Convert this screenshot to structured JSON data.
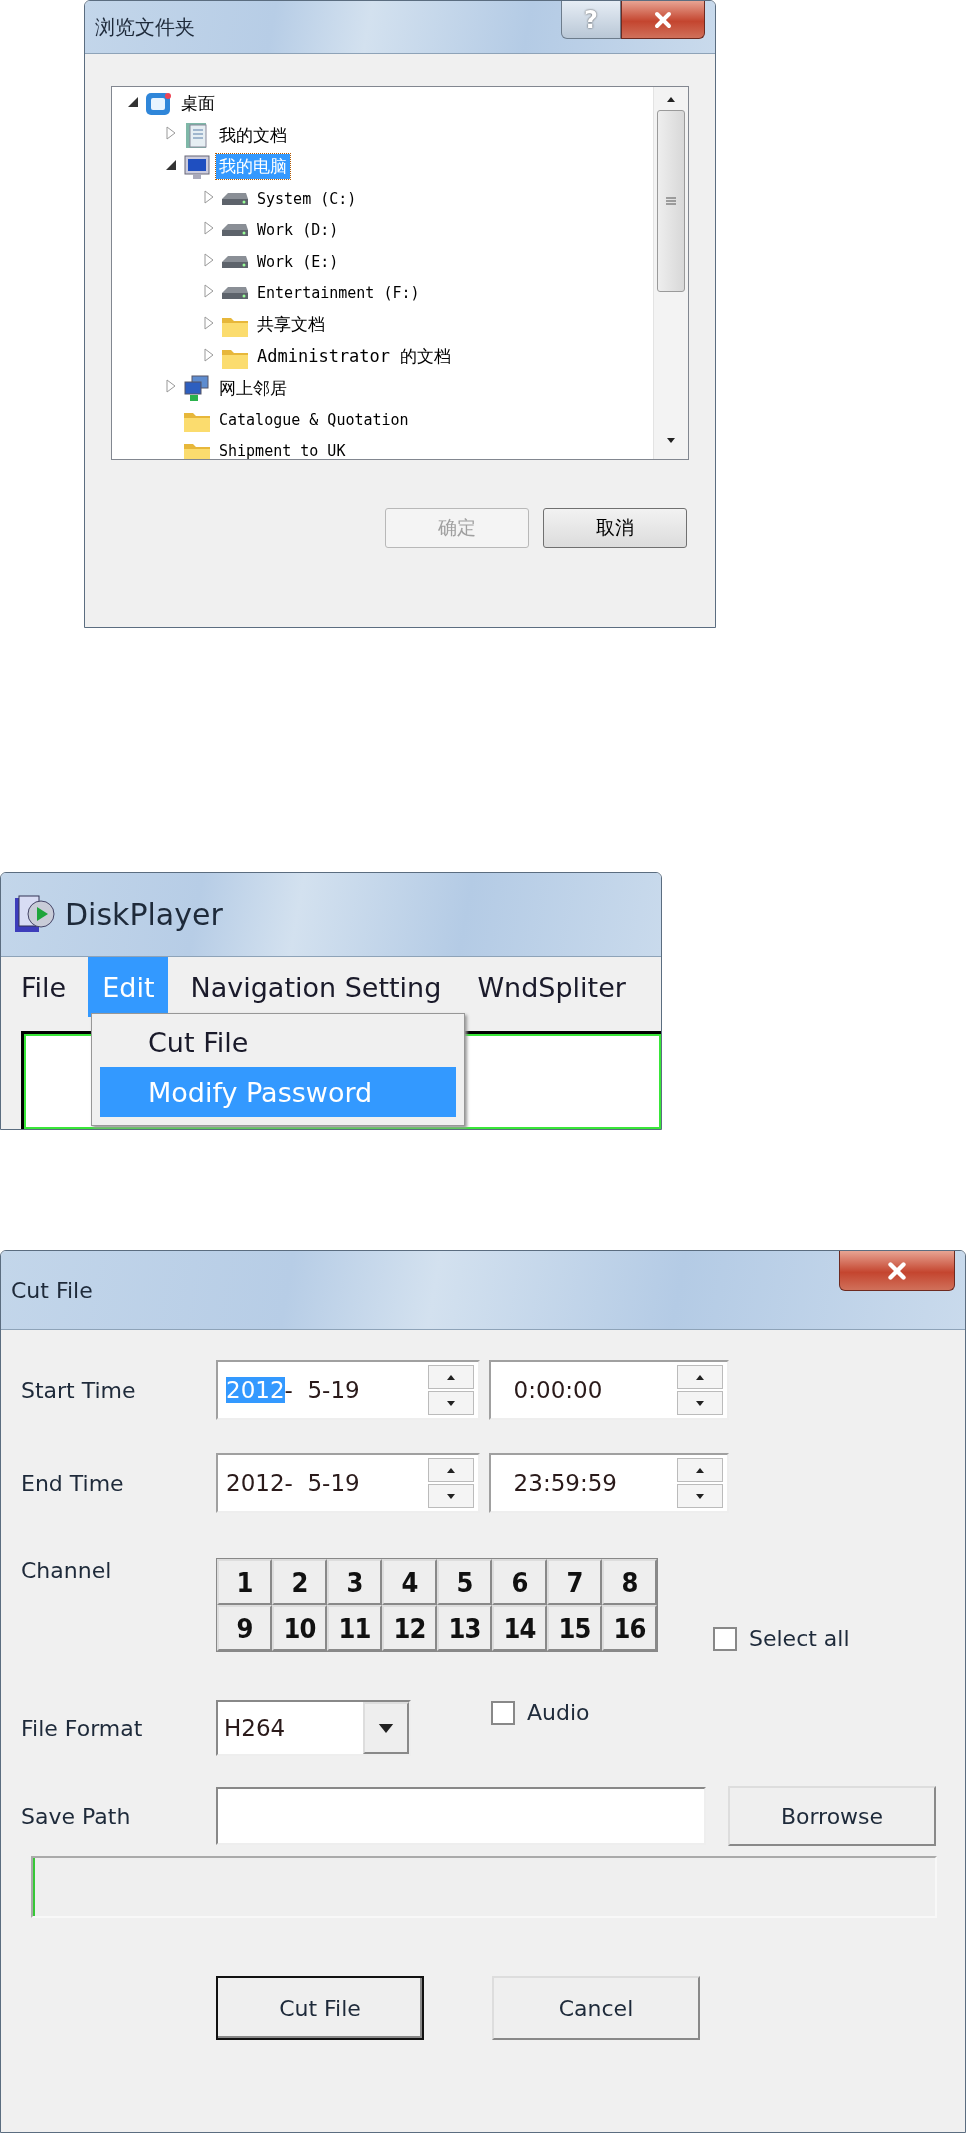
{
  "folder_dialog": {
    "title": "浏览文件夹",
    "help_button": "?",
    "tree": [
      {
        "label": "桌面",
        "kind": "desktop",
        "expanded": true,
        "selected": false,
        "children": [
          {
            "label": "我的文档",
            "kind": "documents",
            "expanded": false,
            "selected": false
          },
          {
            "label": "我的电脑",
            "kind": "computer",
            "expanded": true,
            "selected": true,
            "children": [
              {
                "label": "System (C:)",
                "kind": "drive",
                "expanded": false,
                "selected": false
              },
              {
                "label": "Work (D:)",
                "kind": "drive",
                "expanded": false,
                "selected": false
              },
              {
                "label": "Work (E:)",
                "kind": "drive",
                "expanded": false,
                "selected": false
              },
              {
                "label": "Entertainment (F:)",
                "kind": "drive",
                "expanded": false,
                "selected": false
              },
              {
                "label": "共享文档",
                "kind": "folder",
                "expanded": false,
                "selected": false
              },
              {
                "label": "Administrator 的文档",
                "kind": "folder",
                "expanded": false,
                "selected": false
              }
            ]
          },
          {
            "label": "网上邻居",
            "kind": "network",
            "expanded": false,
            "selected": false
          },
          {
            "label": "Catalogue & Quotation",
            "kind": "folder",
            "selected": false
          },
          {
            "label": "Shipment to UK",
            "kind": "folder",
            "selected": false
          }
        ]
      }
    ],
    "buttons": [
      {
        "label": "确定",
        "disabled": true
      },
      {
        "label": "取消",
        "disabled": false
      }
    ]
  },
  "player_window": {
    "title": "DiskPlayer",
    "menu": [
      {
        "label": "File",
        "selected": false
      },
      {
        "label": "Edit",
        "selected": true
      },
      {
        "label": "Navigation Setting",
        "selected": false
      },
      {
        "label": "WndSpliter",
        "selected": false
      }
    ],
    "dropdown": [
      {
        "label": "Cut File",
        "selected": false
      },
      {
        "label": "Modify Password",
        "selected": true
      }
    ]
  },
  "cut_dialog": {
    "title": "Cut File",
    "times": [
      {
        "label": "Start Time",
        "year": "2012",
        "date_rest": "-  5-19",
        "year_selected": true,
        "time": "0:00:00"
      },
      {
        "label": "End Time",
        "year": "2012",
        "date_rest": "-  5-19",
        "year_selected": false,
        "time": "23:59:59"
      }
    ],
    "channel_label": "Channel",
    "channels": [
      "1",
      "2",
      "3",
      "4",
      "5",
      "6",
      "7",
      "8",
      "9",
      "10",
      "11",
      "12",
      "13",
      "14",
      "15",
      "16"
    ],
    "select_all": {
      "label": "Select all",
      "checked": false
    },
    "file_format": {
      "label": "File Format",
      "value": "H264"
    },
    "audio": {
      "label": "Audio",
      "checked": false
    },
    "save_path": {
      "label": "Save Path"
    },
    "browse_button": "Borrowse",
    "progress": {
      "level": 0
    },
    "buttons": [
      {
        "label": "Cut File",
        "default": true
      },
      {
        "label": "Cancel",
        "default": false
      }
    ]
  }
}
